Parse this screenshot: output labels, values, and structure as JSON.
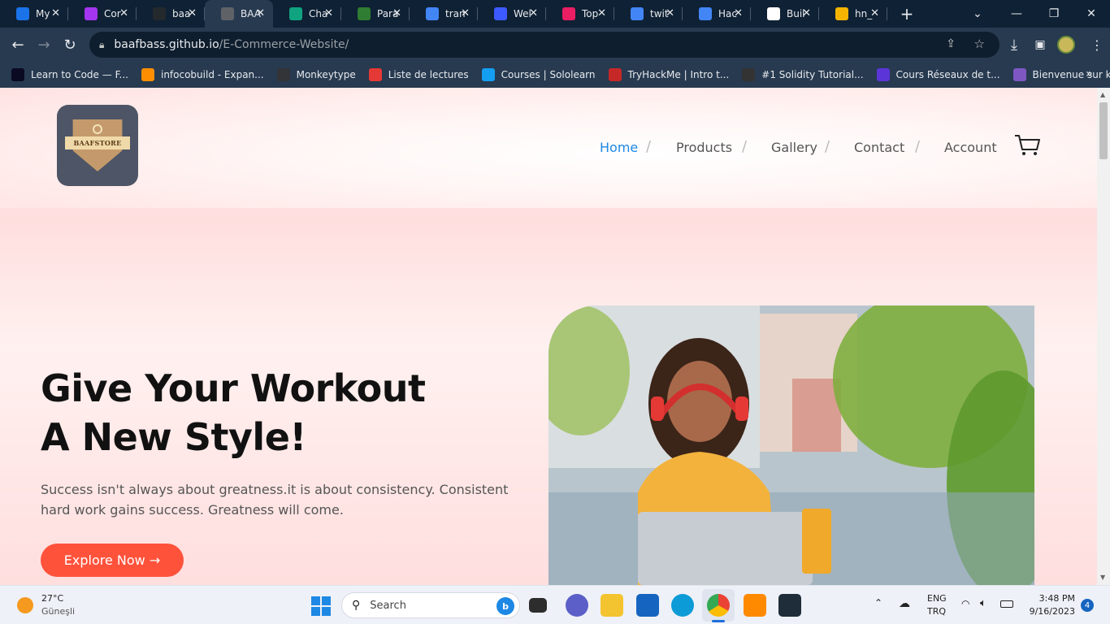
{
  "browser": {
    "tabs": [
      {
        "title": "My",
        "icon": "settings-icon",
        "color": "#1a73e8",
        "active": false
      },
      {
        "title": "Cor",
        "icon": "udemy-icon",
        "color": "#a435f0",
        "active": false
      },
      {
        "title": "baa",
        "icon": "github-icon",
        "color": "#24292e",
        "active": false
      },
      {
        "title": "BAA",
        "icon": "globe-icon",
        "color": "#5f6368",
        "active": true
      },
      {
        "title": "Cha",
        "icon": "chatgpt-icon",
        "color": "#10a37f",
        "active": false
      },
      {
        "title": "Para",
        "icon": "android-icon",
        "color": "#2e7d32",
        "active": false
      },
      {
        "title": "tran",
        "icon": "google-icon",
        "color": "#4285f4",
        "active": false
      },
      {
        "title": "Wel",
        "icon": "feather-icon",
        "color": "#3d5afe",
        "active": false
      },
      {
        "title": "Top",
        "icon": "stack-icon",
        "color": "#e91e63",
        "active": false
      },
      {
        "title": "twit",
        "icon": "google-icon",
        "color": "#4285f4",
        "active": false
      },
      {
        "title": "Hac",
        "icon": "google-icon",
        "color": "#4285f4",
        "active": false
      },
      {
        "title": "Buil",
        "icon": "r-icon",
        "color": "#ffffff",
        "active": false
      },
      {
        "title": "hn_",
        "icon": "bird-icon",
        "color": "#f4b400",
        "active": false
      }
    ],
    "url_host": "baafbass.github.io",
    "url_path": "/E-Commerce-Website/",
    "bookmarks": [
      {
        "label": "Learn to Code — F...",
        "color": "#0a0a23"
      },
      {
        "label": "infocobuild - Expan...",
        "color": "#ff8f00"
      },
      {
        "label": "Monkeytype",
        "color": "#323437"
      },
      {
        "label": "Liste de lectures",
        "color": "#e53935"
      },
      {
        "label": "Courses | Sololearn",
        "color": "#149ef2"
      },
      {
        "label": "TryHackMe | Intro t...",
        "color": "#c62828"
      },
      {
        "label": "#1 Solidity Tutorial...",
        "color": "#333333"
      },
      {
        "label": "Cours Réseaux de t...",
        "color": "#5c35d9"
      },
      {
        "label": "Bienvenue sur koob...",
        "color": "#7e57c2"
      }
    ]
  },
  "site": {
    "logo_text": "BAAFSTORE",
    "nav": [
      "Home",
      "Products",
      "Gallery",
      "Contact",
      "Account"
    ],
    "hero_title_line1": "Give Your Workout",
    "hero_title_line2": "A New Style!",
    "hero_subtitle": "Success isn't always about greatness.it is about consistency. Consistent hard work gains success. Greatness will come.",
    "cta_label": "Explore Now →",
    "accent": "#ff523b",
    "active_nav_color": "#1e88e5"
  },
  "taskbar": {
    "weather_temp": "27°C",
    "weather_desc": "Güneşli",
    "search_placeholder": "Search",
    "lang_primary": "ENG",
    "lang_secondary": "TRQ",
    "time": "3:48 PM",
    "date": "9/16/2023",
    "notification_count": "4"
  }
}
